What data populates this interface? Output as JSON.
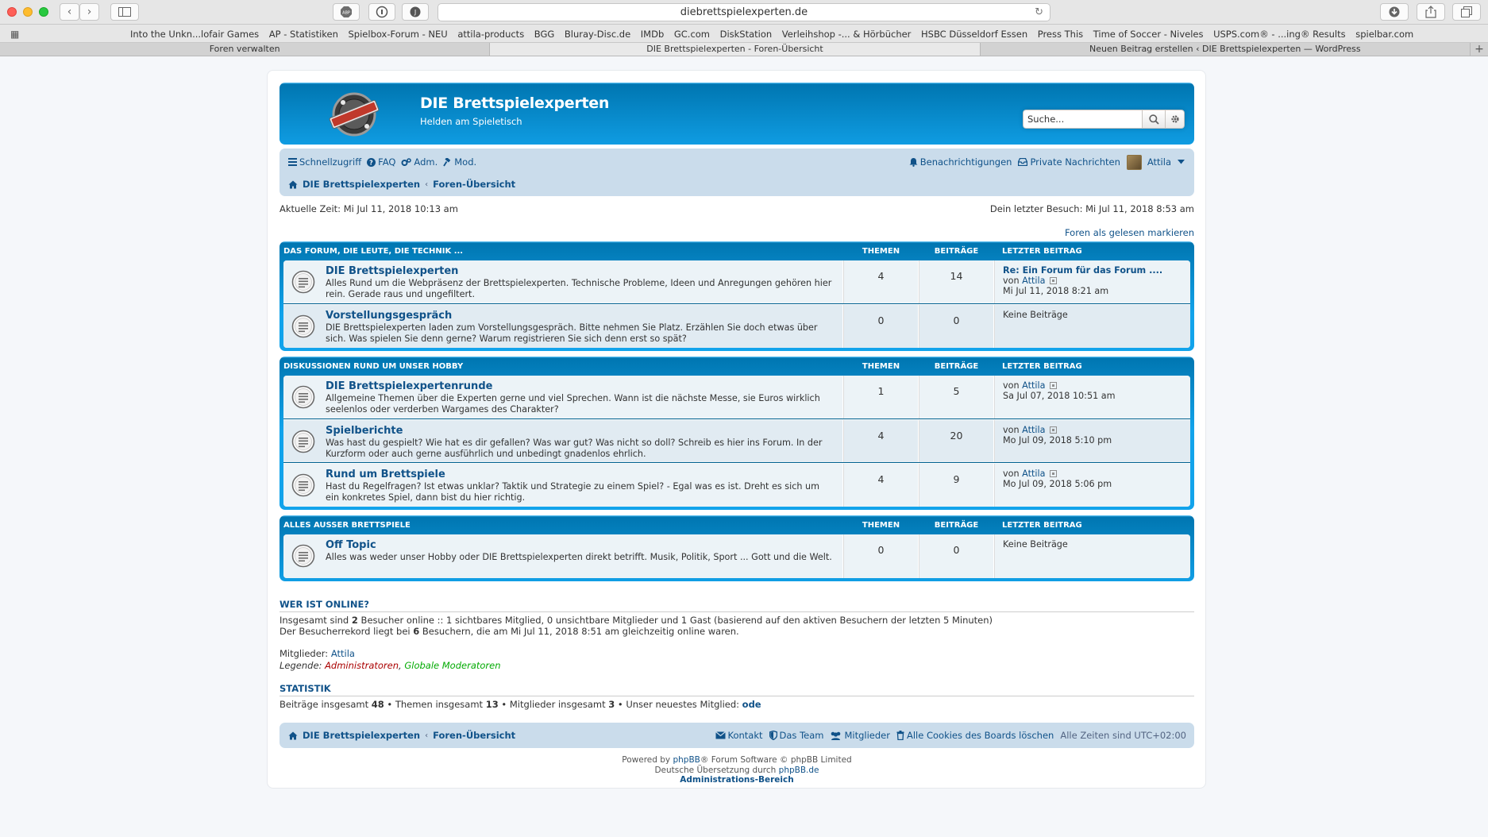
{
  "browser": {
    "url": "diebrettspielexperten.de",
    "bookmarks": [
      "Into the Unkn...lofair Games",
      "AP - Statistiken",
      "Spielbox-Forum - NEU",
      "attila-products",
      "BGG",
      "Bluray-Disc.de",
      "IMDb",
      "GC.com",
      "DiskStation",
      "Verleihshop -... & Hörbücher",
      "HSBC Düsseldorf Essen",
      "Press This",
      "Time of Soccer - Niveles",
      "USPS.com® - ...ing® Results",
      "spielbar.com"
    ],
    "tabs": [
      "Foren verwalten",
      "DIE Brettspielexperten - Foren-Übersicht",
      "Neuen Beitrag erstellen ‹ DIE Brettspielexperten — WordPress"
    ],
    "active_tab": 1
  },
  "header": {
    "site_title": "DIE Brettspielexperten",
    "site_desc": "Helden am Spieletisch",
    "search_placeholder": "Suche..."
  },
  "nav": {
    "quick": "Schnellzugriff",
    "faq": "FAQ",
    "adm": "Adm.",
    "mod": "Mod.",
    "notifications": "Benachrichtigungen",
    "pm": "Private Nachrichten",
    "user": "Attila"
  },
  "crumbs": {
    "home": "DIE Brettspielexperten",
    "sep": "‹",
    "current": "Foren-Übersicht"
  },
  "info": {
    "current_time": "Aktuelle Zeit: Mi Jul 11, 2018 10:13 am",
    "last_visit": "Dein letzter Besuch: Mi Jul 11, 2018 8:53 am",
    "mark_read": "Foren als gelesen markieren"
  },
  "columns": {
    "topics": "THEMEN",
    "posts": "BEITRÄGE",
    "last": "LETZTER BEITRAG"
  },
  "categories": [
    {
      "name": "DAS FORUM, DIE LEUTE, DIE TECHNIK ...",
      "forums": [
        {
          "title": "DIE Brettspielexperten",
          "desc": "Alles Rund um die Webpräsenz der Brettspielexperten. Technische Probleme, Ideen und Anregungen gehören hier rein. Gerade raus und ungefiltert.",
          "topics": "4",
          "posts": "14",
          "last_title": "Re: Ein Forum für das Forum ....",
          "last_by": "von",
          "last_author": "Attila",
          "last_date": "Mi Jul 11, 2018 8:21 am"
        },
        {
          "title": "Vorstellungsgespräch",
          "desc": "DIE Brettspielexperten laden zum Vorstellungsgespräch. Bitte nehmen Sie Platz. Erzählen Sie doch etwas über sich. Was spielen Sie denn gerne? Warum registrieren Sie sich denn erst so spät?",
          "topics": "0",
          "posts": "0",
          "no_posts": "Keine Beiträge"
        }
      ]
    },
    {
      "name": "DISKUSSIONEN RUND UM UNSER HOBBY",
      "forums": [
        {
          "title": "DIE Brettspielexpertenrunde",
          "desc": "Allgemeine Themen über die Experten gerne und viel Sprechen. Wann ist die nächste Messe, sie Euros wirklich seelenlos oder verderben Wargames des Charakter?",
          "topics": "1",
          "posts": "5",
          "last_by": "von",
          "last_author": "Attila",
          "last_date": "Sa Jul 07, 2018 10:51 am"
        },
        {
          "title": "Spielberichte",
          "desc": "Was hast du gespielt? Wie hat es dir gefallen? Was war gut? Was nicht so doll? Schreib es hier ins Forum. In der Kurzform oder auch gerne ausführlich und unbedingt gnadenlos ehrlich.",
          "topics": "4",
          "posts": "20",
          "last_by": "von",
          "last_author": "Attila",
          "last_date": "Mo Jul 09, 2018 5:10 pm"
        },
        {
          "title": "Rund um Brettspiele",
          "desc": "Hast du Regelfragen? Ist etwas unklar? Taktik und Strategie zu einem Spiel? - Egal was es ist. Dreht es sich um ein konkretes Spiel, dann bist du hier richtig.",
          "topics": "4",
          "posts": "9",
          "last_by": "von",
          "last_author": "Attila",
          "last_date": "Mo Jul 09, 2018 5:06 pm"
        }
      ]
    },
    {
      "name": "ALLES AUSSER BRETTSPIELE",
      "forums": [
        {
          "title": "Off Topic",
          "desc": "Alles was weder unser Hobby oder DIE Brettspielexperten direkt betrifft. Musik, Politik, Sport ... Gott und die Welt.",
          "topics": "0",
          "posts": "0",
          "no_posts": "Keine Beiträge"
        }
      ]
    }
  ],
  "online": {
    "title": "WER IST ONLINE?",
    "line1_pre": "Insgesamt sind ",
    "line1_num": "2",
    "line1_post": " Besucher online :: 1 sichtbares Mitglied, 0 unsichtbare Mitglieder und 1 Gast (basierend auf den aktiven Besuchern der letzten 5 Minuten)",
    "line2_pre": "Der Besucherrekord liegt bei ",
    "line2_num": "6",
    "line2_post": " Besuchern, die am Mi Jul 11, 2018 8:51 am gleichzeitig online waren.",
    "members_label": "Mitglieder: ",
    "members": "Attila",
    "legend_label": "Legende: ",
    "legend_admin": "Administratoren",
    "legend_sep": ", ",
    "legend_mod": "Globale Moderatoren"
  },
  "stats": {
    "title": "STATISTIK",
    "posts_label": "Beiträge insgesamt ",
    "posts": "48",
    "topics_label": " • Themen insgesamt ",
    "topics": "13",
    "members_label": " • Mitglieder insgesamt ",
    "members": "3",
    "newest_label": " • Unser neuestes Mitglied: ",
    "newest": "ode"
  },
  "footer": {
    "contact": "Kontakt",
    "team": "Das Team",
    "members": "Mitglieder",
    "cookies": "Alle Cookies des Boards löschen",
    "timezone": "Alle Zeiten sind UTC+02:00",
    "powered_pre": "Powered by ",
    "phpbb": "phpBB",
    "powered_post": "® Forum Software © phpBB Limited",
    "translation_pre": "Deutsche Übersetzung durch ",
    "translation_link": "phpBB.de",
    "admin": "Administrations-Bereich"
  },
  "colors": {
    "header_blue": "#12a3eb",
    "nav_bg": "#cadceb",
    "link": "#105289",
    "admin": "#aa0000",
    "mod": "#00aa00"
  }
}
